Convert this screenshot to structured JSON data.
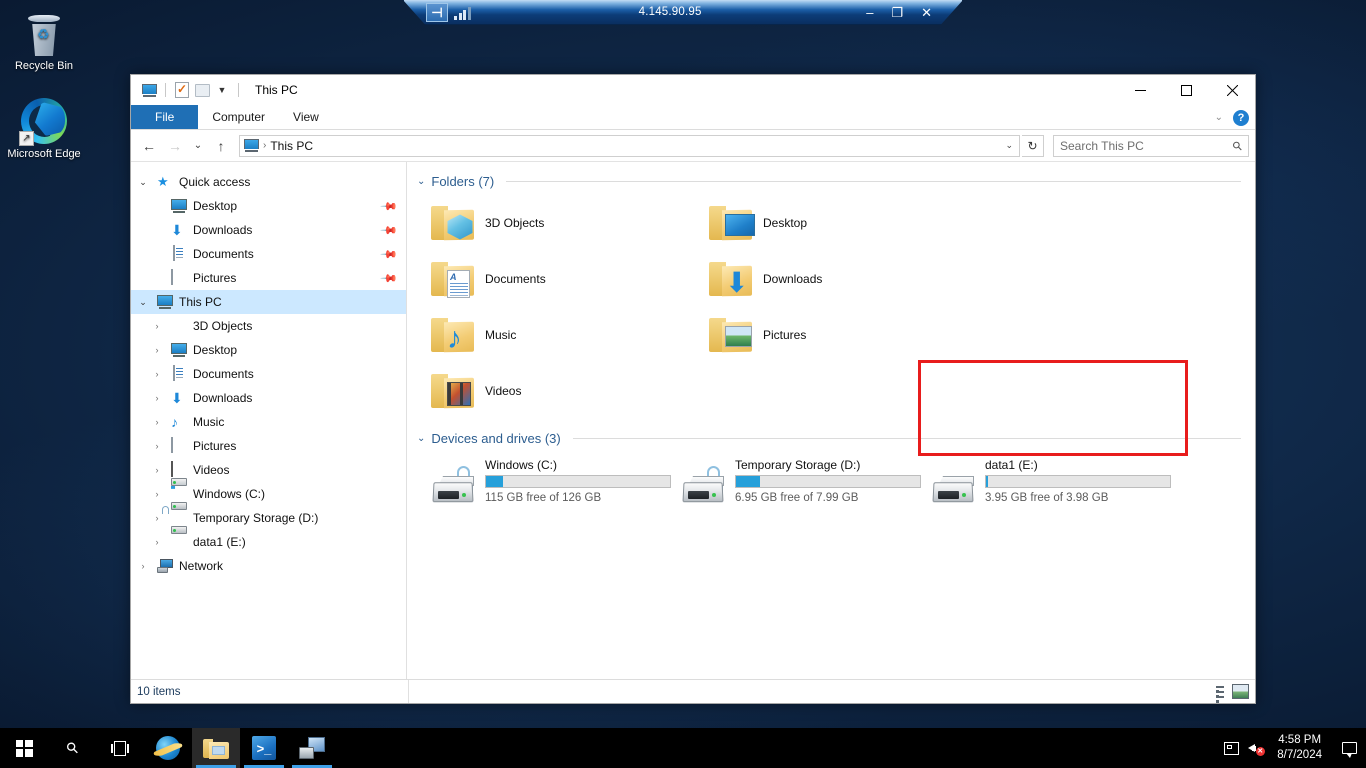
{
  "rdp_bar": {
    "address": "4.145.90.95",
    "pin_icon": "pin-icon",
    "signal_icon": "signal-strength-icon",
    "minimize": "–",
    "restore": "❐",
    "close": "✕"
  },
  "desktop": {
    "icons": [
      {
        "label": "Recycle Bin",
        "icon": "recycle-bin-icon"
      },
      {
        "label": "Microsoft Edge",
        "icon": "microsoft-edge-icon"
      }
    ]
  },
  "explorer": {
    "title": "This PC",
    "quick_access_toolbar": [
      {
        "name": "this-pc-icon"
      },
      {
        "name": "properties-icon"
      },
      {
        "name": "new-folder-icon"
      },
      {
        "name": "customize-caret-icon"
      }
    ],
    "window_controls": {
      "minimize": "minimize-icon",
      "maximize": "maximize-icon",
      "close": "close-icon"
    },
    "ribbon": {
      "tabs": [
        {
          "label": "File",
          "active": true
        },
        {
          "label": "Computer",
          "active": false
        },
        {
          "label": "View",
          "active": false
        }
      ],
      "collapse_caret": "⌄",
      "help_label": "?"
    },
    "address_bar": {
      "back_icon": "back-arrow-icon",
      "forward_icon": "forward-arrow-icon",
      "recent_icon": "recent-locations-icon",
      "up_icon": "up-arrow-icon",
      "crumb_icon": "this-pc-icon",
      "crumb_separator": "›",
      "path": "This PC",
      "dropdown_icon": "⌄",
      "refresh_icon": "↻"
    },
    "search": {
      "placeholder": "Search This PC",
      "icon": "search-icon"
    },
    "nav_pane": {
      "groups": [
        {
          "label": "Quick access",
          "icon": "star-icon",
          "expanded": true,
          "children": [
            {
              "label": "Desktop",
              "icon": "desktop-icon",
              "pinned": true
            },
            {
              "label": "Downloads",
              "icon": "downloads-icon",
              "pinned": true
            },
            {
              "label": "Documents",
              "icon": "documents-icon",
              "pinned": true
            },
            {
              "label": "Pictures",
              "icon": "pictures-icon",
              "pinned": true
            }
          ]
        },
        {
          "label": "This PC",
          "icon": "this-pc-icon",
          "expanded": true,
          "selected": true,
          "children": [
            {
              "label": "3D Objects",
              "icon": "3d-objects-icon"
            },
            {
              "label": "Desktop",
              "icon": "desktop-icon"
            },
            {
              "label": "Documents",
              "icon": "documents-icon"
            },
            {
              "label": "Downloads",
              "icon": "downloads-icon"
            },
            {
              "label": "Music",
              "icon": "music-icon"
            },
            {
              "label": "Pictures",
              "icon": "pictures-icon"
            },
            {
              "label": "Videos",
              "icon": "videos-icon"
            },
            {
              "label": "Windows (C:)",
              "icon": "drive-windows-icon"
            },
            {
              "label": "Temporary Storage (D:)",
              "icon": "drive-icon"
            },
            {
              "label": "data1 (E:)",
              "icon": "drive-icon"
            }
          ]
        },
        {
          "label": "Network",
          "icon": "network-icon",
          "expanded": false,
          "children": []
        }
      ]
    },
    "content": {
      "folders_group": {
        "label": "Folders (7)",
        "chevron": "⌄",
        "items": [
          {
            "label": "3D Objects",
            "icon": "folder-3d-objects-icon"
          },
          {
            "label": "Desktop",
            "icon": "folder-desktop-icon"
          },
          {
            "label": "Documents",
            "icon": "folder-documents-icon"
          },
          {
            "label": "Downloads",
            "icon": "folder-downloads-icon"
          },
          {
            "label": "Music",
            "icon": "folder-music-icon"
          },
          {
            "label": "Pictures",
            "icon": "folder-pictures-icon"
          },
          {
            "label": "Videos",
            "icon": "folder-videos-icon"
          }
        ]
      },
      "drives_group": {
        "label": "Devices and drives (3)",
        "chevron": "⌄",
        "items": [
          {
            "label": "Windows (C:)",
            "free_text": "115 GB free of 126 GB",
            "used_percent": 9,
            "icon": "drive-bitlocker-icon",
            "highlighted": false
          },
          {
            "label": "Temporary Storage (D:)",
            "free_text": "6.95 GB free of 7.99 GB",
            "used_percent": 13,
            "icon": "drive-bitlocker-icon",
            "highlighted": false
          },
          {
            "label": "data1 (E:)",
            "free_text": "3.95 GB free of 3.98 GB",
            "used_percent": 1,
            "icon": "drive-icon",
            "highlighted": true
          }
        ]
      },
      "highlight_color": "#e81c1c"
    },
    "status_bar": {
      "item_count": "10 items",
      "view_buttons": [
        {
          "name": "details-view-button"
        },
        {
          "name": "large-icons-view-button"
        }
      ]
    }
  },
  "taskbar": {
    "start_icon": "windows-start-icon",
    "search_icon": "search-icon",
    "task_view_icon": "task-view-icon",
    "apps": [
      {
        "name": "internet-explorer-icon",
        "running": false
      },
      {
        "name": "file-explorer-icon",
        "running": true,
        "active": true
      },
      {
        "name": "windows-powershell-icon",
        "running": true
      },
      {
        "name": "remote-desktop-icon",
        "running": true
      }
    ],
    "tray": {
      "network_icon": "network-tray-icon",
      "volume_icon": "volume-muted-icon",
      "time": "4:58 PM",
      "date": "8/7/2024",
      "action_center_icon": "action-center-icon"
    }
  },
  "theme": {
    "accent": "#26a0da",
    "ribbon_file": "#1f6fb5",
    "selection": "#cce8ff",
    "group_header": "#2c5d8f"
  }
}
